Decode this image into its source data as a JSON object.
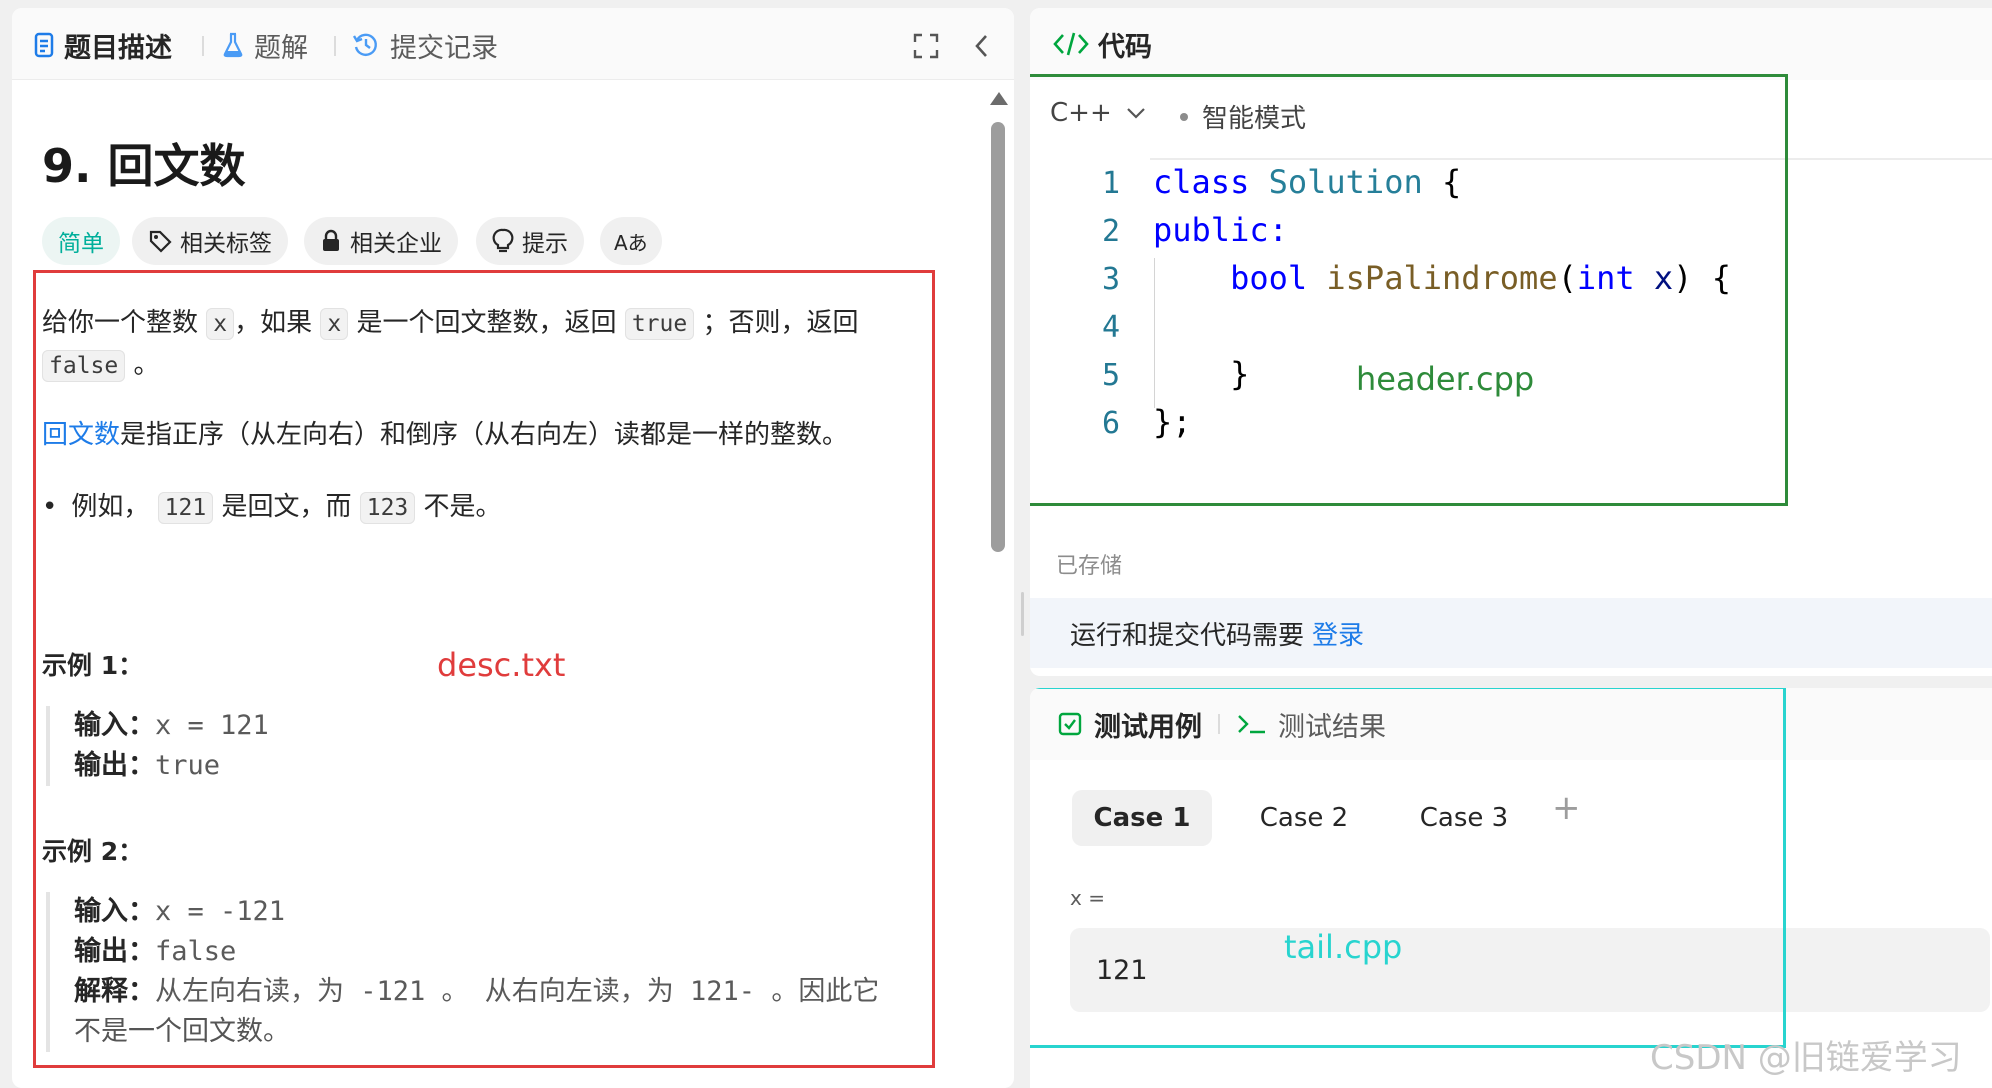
{
  "left_tabs": [
    {
      "label": "题目描述",
      "icon": "description-icon"
    },
    {
      "label": "题解",
      "icon": "flask-icon"
    },
    {
      "label": "提交记录",
      "icon": "history-icon"
    }
  ],
  "problem": {
    "title": "9. 回文数",
    "difficulty": "简单",
    "chips": [
      "相关标签",
      "相关企业",
      "提示",
      "Aあ"
    ],
    "desc": {
      "p1_a": "给你一个整数",
      "p1_code1": "x",
      "p1_b": "，如果",
      "p1_code2": "x",
      "p1_c": "是一个回文整数，返回",
      "p1_code3": "true",
      "p1_d": "；否则，返回",
      "p1_code4": "false",
      "p1_e": "。",
      "p2_link": "回文数",
      "p2_text": "是指正序（从左向右）和倒序（从右向左）读都是一样的整数。",
      "bullet_a": "例如，",
      "bullet_code1": "121",
      "bullet_b": "是回文，而",
      "bullet_code2": "123",
      "bullet_c": "不是。"
    },
    "examples": [
      {
        "heading": "示例 1：",
        "input_label": "输入：",
        "input": "x = 121",
        "output_label": "输出：",
        "output": "true"
      },
      {
        "heading": "示例 2：",
        "input_label": "输入：",
        "input": "x = -121",
        "output_label": "输出：",
        "output": "false",
        "explain_label": "解释：",
        "explain": "从左向右读，为 -121 。 从右向左读，为 121- 。因此它",
        "explain_2": "不是一个回文数。"
      }
    ]
  },
  "annotations": {
    "desc": "desc.txt",
    "header": "header.cpp",
    "tail": "tail.cpp"
  },
  "annotation_colors": {
    "desc": "#e03c3c",
    "header": "#2e8b3a",
    "tail": "#28d4cf"
  },
  "code_panel": {
    "title": "代码",
    "language": "C++",
    "mode": "智能模式",
    "saved": "已存储",
    "login_text": "运行和提交代码需要",
    "login_link": "登录"
  },
  "code_lines": [
    "1",
    "2",
    "3",
    "4",
    "5",
    "6"
  ],
  "code_tokens": {
    "l1_kw": "class",
    "l1_type": "Solution",
    "l1_rest": " {",
    "l2_kw": "public:",
    "l3_type": "bool",
    "l3_fn": "isPalindrome",
    "l3_paren": "(",
    "l3_kw": "int",
    "l3_param": "x",
    "l3_rest": ") {",
    "l5": "}",
    "l6": "};"
  },
  "test_panel": {
    "tab_active": "测试用例",
    "tab_other": "测试结果",
    "cases": [
      "Case 1",
      "Case 2",
      "Case 3"
    ],
    "add": "+",
    "var_label": "x =",
    "var_value": "121"
  },
  "watermark": "CSDN @旧链爱学习"
}
